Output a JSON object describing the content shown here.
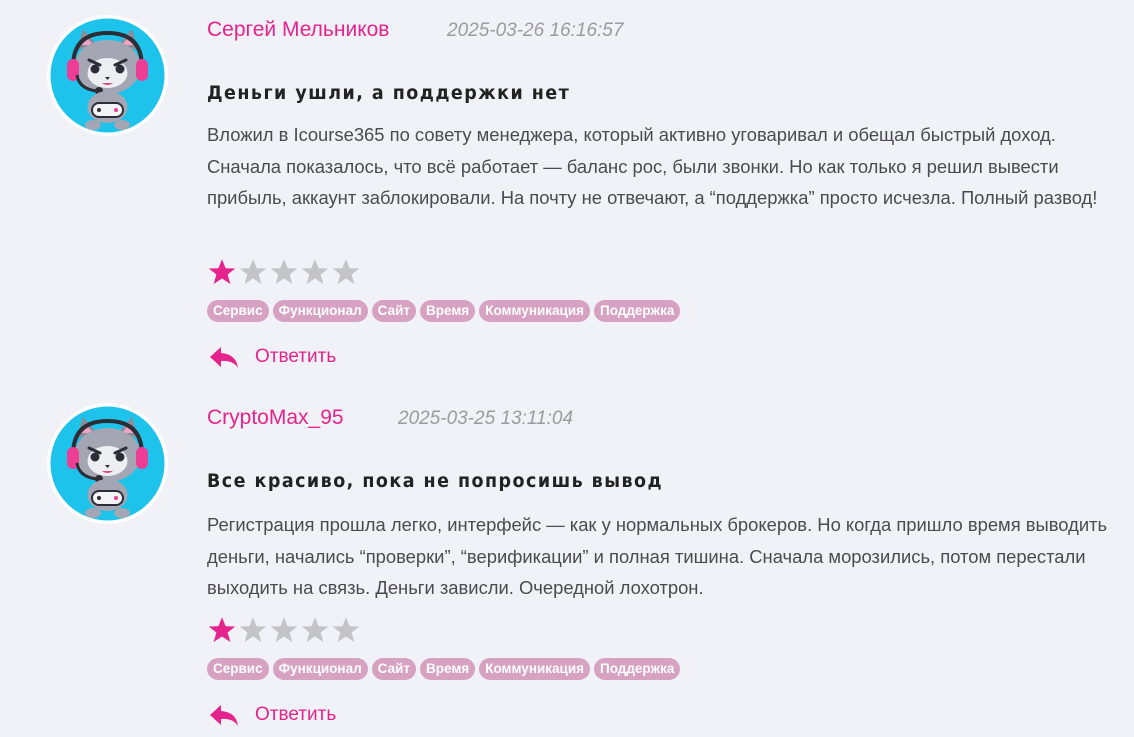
{
  "reviews": [
    {
      "author": "Сергей Мельников",
      "date": "2025-03-26 16:16:57",
      "title": "Деньги ушли, а поддержки нет",
      "text": "Вложил в Icourse365 по совету менеджера, который активно уговаривал и обещал быстрый доход. Сначала показалось, что всё работает — баланс рос, были звонки. Но как только я решил вывести прибыль, аккаунт заблокировали. На почту не отвечают, а “поддержка” просто исчезла. Полный развод!",
      "rating": 1,
      "max_rating": 5,
      "tags": [
        "Сервис",
        "Функционал",
        "Сайт",
        "Время",
        "Коммуникация",
        "Поддержка"
      ],
      "reply_label": "Ответить",
      "avatar_icon": "gamer-cat-avatar-icon"
    },
    {
      "author": "CryptoMax_95",
      "date": "2025-03-25 13:11:04",
      "title": "Все красиво, пока не попросишь вывод",
      "text": "Регистрация прошла легко, интерфейс — как у нормальных брокеров. Но когда пришло время выводить деньги, начались “проверки”, “верификации” и полная тишина. Сначала морозились, потом перестали выходить на связь. Деньги зависли. Очередной лохотрон.",
      "rating": 1,
      "max_rating": 5,
      "tags": [
        "Сервис",
        "Функционал",
        "Сайт",
        "Время",
        "Коммуникация",
        "Поддержка"
      ],
      "reply_label": "Ответить",
      "avatar_icon": "gamer-cat-avatar-icon"
    }
  ],
  "colors": {
    "accent": "#e4238d",
    "tag_bg": "#d7a1c2",
    "star_on": "#e4238d",
    "star_off": "#c4c4c8",
    "background": "#f1f2f7"
  }
}
